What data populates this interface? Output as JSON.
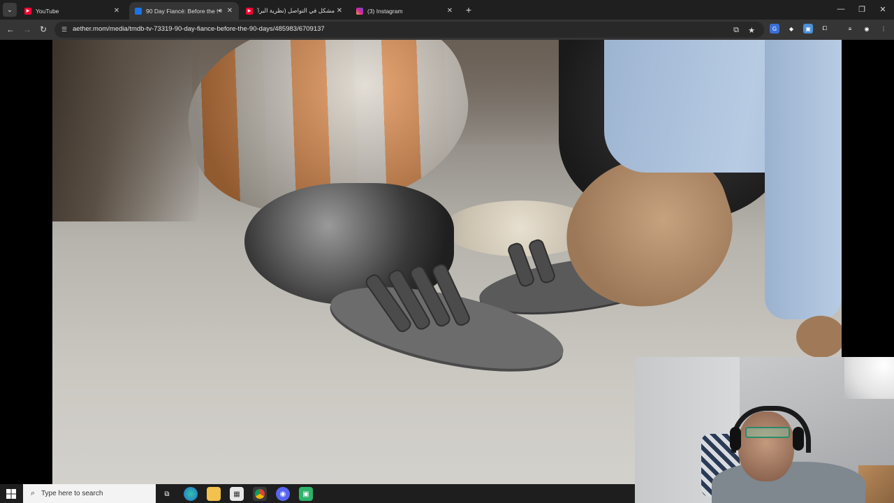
{
  "browser": {
    "tabs": [
      {
        "title": "YouTube",
        "favicon": "youtube-icon",
        "color": "#ff0033",
        "active": false
      },
      {
        "title": "90 Day Fiancé: Before the 9",
        "favicon": "site-icon",
        "color": "#1a73e8",
        "active": true,
        "audio": true
      },
      {
        "title": "مشكل في التواصل (نظرية البراكـ",
        "favicon": "youtube-icon",
        "color": "#ff0033",
        "active": false
      },
      {
        "title": "(3) Instagram",
        "favicon": "instagram-icon",
        "color": "#d6249f",
        "active": false
      }
    ],
    "url": "aether.mom/media/tmdb-tv-73319-90-day-fiance-before-the-90-days/485983/6709137"
  },
  "taskbar": {
    "search_placeholder": "Type here to search",
    "apps": [
      "task-view-icon",
      "edge-icon",
      "file-explorer-icon",
      "microsoft-store-icon",
      "chrome-icon",
      "discord-icon",
      "app-icon"
    ]
  },
  "colors": {
    "tabstrip": "#1f1f1f",
    "toolbar": "#353535",
    "omnibox": "#282828",
    "taskbar": "#1e1e1e"
  }
}
